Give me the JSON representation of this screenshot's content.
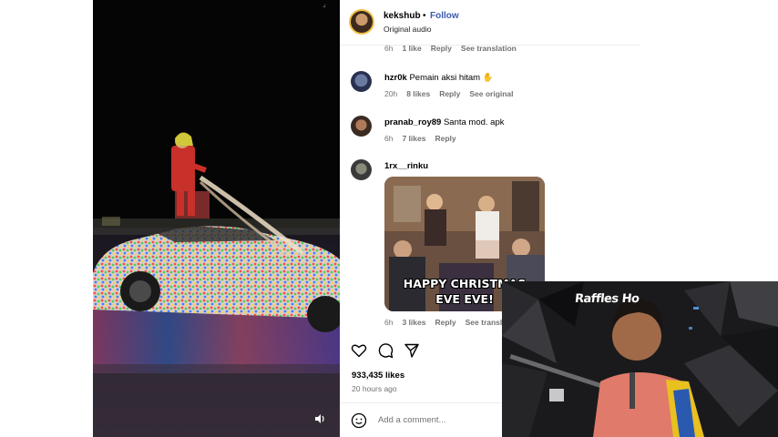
{
  "post": {
    "username": "kekshub",
    "separator": "•",
    "follow_label": "Follow",
    "audio": "Original audio"
  },
  "top_comment_meta": {
    "time": "6h",
    "likes": "1 like",
    "reply": "Reply",
    "translation": "See translation"
  },
  "comments": [
    {
      "username": "hzr0k",
      "text": "Pemain aksi hitam ✋",
      "time": "20h",
      "likes": "8 likes",
      "reply": "Reply",
      "extra": "See original"
    },
    {
      "username": "pranab_roy89",
      "text": "Santa mod. apk",
      "time": "6h",
      "likes": "7 likes",
      "reply": "Reply",
      "extra": ""
    },
    {
      "username": "1rx__rinku",
      "text": "",
      "time": "6h",
      "likes": "3 likes",
      "reply": "Reply",
      "extra": "See translat"
    }
  ],
  "gif": {
    "line1": "HAPPY CHRISTMAS",
    "line2": "EVE EVE!"
  },
  "stats": {
    "likes": "933,435 likes",
    "posted": "20 hours ago"
  },
  "add_comment_placeholder": "Add a comment...",
  "webcam": {
    "sign_text": "Raffles Ho"
  },
  "icons": {
    "like": "heart-icon",
    "comment": "comment-bubble-icon",
    "share": "share-paper-plane-icon",
    "emoji": "smiley-icon",
    "mute": "speaker-icon"
  },
  "colors": {
    "follow": "#3b5ab0",
    "muted_text": "#737373",
    "story_ring": "#f2c24a"
  }
}
